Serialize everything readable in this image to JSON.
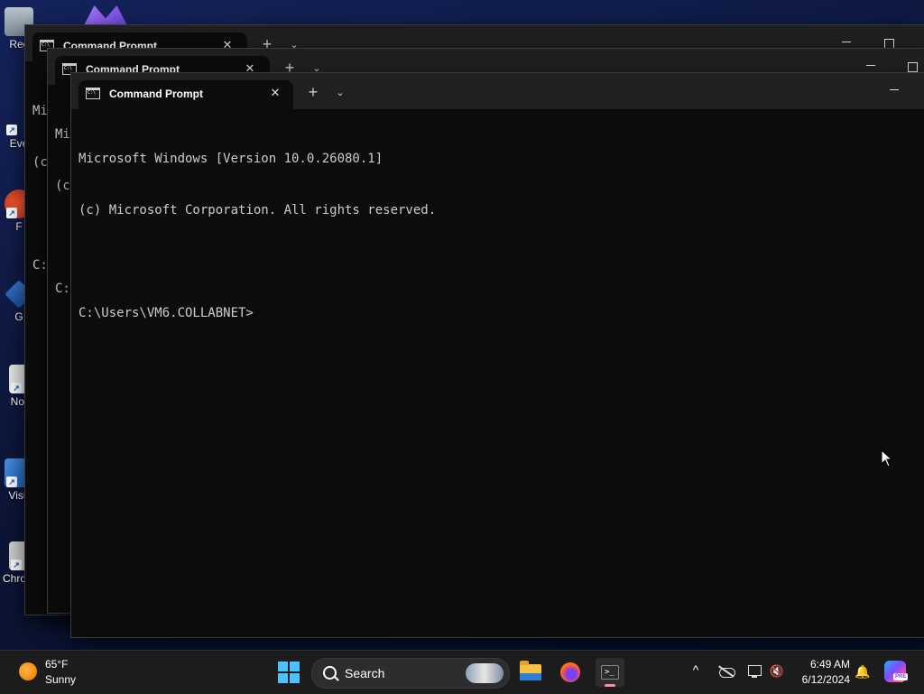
{
  "desktop": {
    "icons": [
      {
        "label": "Rec"
      },
      {
        "label": "Eve"
      },
      {
        "label": "F"
      },
      {
        "label": "G"
      },
      {
        "label": "Not"
      },
      {
        "label": "Visu"
      },
      {
        "label": "Chrom"
      }
    ]
  },
  "windows": {
    "back": {
      "tab_title": "Command Prompt",
      "lines": [
        "Mi",
        "(c",
        "",
        "C:"
      ]
    },
    "middle": {
      "tab_title": "Command Prompt",
      "lines": [
        "Mi",
        "(c",
        "",
        "C:"
      ]
    },
    "active": {
      "tab_title": "Command Prompt",
      "lines": [
        "Microsoft Windows [Version 10.0.26080.1]",
        "(c) Microsoft Corporation. All rights reserved.",
        "",
        "C:\\Users\\VM6.COLLABNET>"
      ]
    },
    "close_glyph": "✕",
    "new_tab_glyph": "+",
    "dropdown_glyph": "⌄"
  },
  "taskbar": {
    "weather": {
      "temperature": "65°F",
      "condition": "Sunny",
      "icon": "sun-icon"
    },
    "search": {
      "placeholder": "Search"
    },
    "apps": [
      "file-explorer-icon",
      "firefox-icon",
      "terminal-icon"
    ],
    "tray": {
      "chevron": "^",
      "time": "6:49 AM",
      "date": "6/12/2024",
      "volume_glyph": "🔇",
      "bell_glyph": "🔔",
      "copilot_badge": "PRE"
    }
  }
}
